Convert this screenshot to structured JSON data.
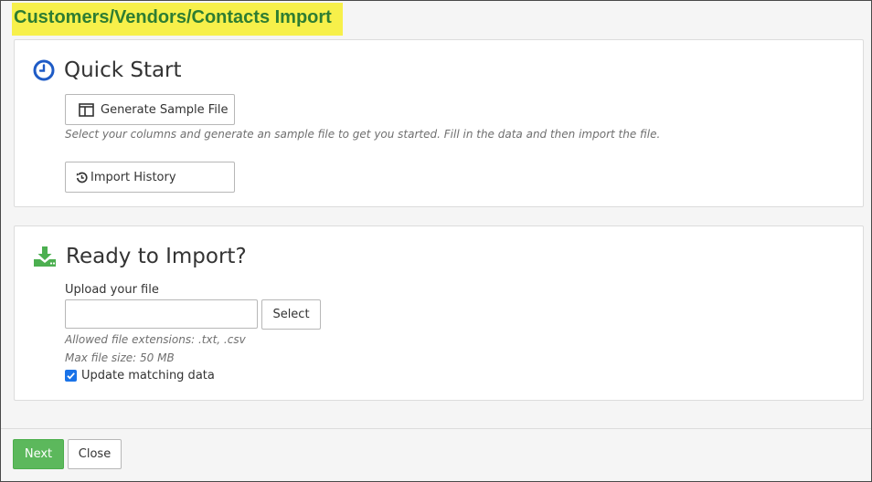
{
  "page": {
    "title": "Customers/Vendors/Contacts Import",
    "title_highlight_color": "#f7f04a",
    "title_color": "#2e7d32"
  },
  "quick_start": {
    "heading": "Quick Start",
    "heading_icon": "clock-icon",
    "generate_button_label": "Generate Sample File",
    "generate_button_icon": "columns-icon",
    "hint": "Select your columns and generate an sample file to get you started. Fill in the data and then import the file.",
    "history_button_label": "Import History",
    "history_button_icon": "history-icon"
  },
  "ready": {
    "heading": "Ready to Import?",
    "heading_icon": "download-icon",
    "upload_label": "Upload your file",
    "file_value": "",
    "select_button_label": "Select",
    "allowed_extensions": "Allowed file extensions: .txt, .csv",
    "max_size": "Max file size: 50 MB",
    "update_matching_label": "Update matching data",
    "update_matching_checked": true
  },
  "footer": {
    "next_label": "Next",
    "close_label": "Close",
    "next_color": "#5cb85c"
  }
}
